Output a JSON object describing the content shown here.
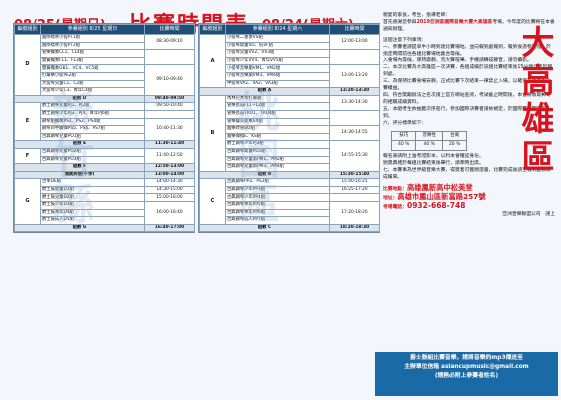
{
  "title": {
    "date_left": "08/25(星期日)",
    "main": "比賽時間表",
    "date_right": "08/24(星期六)"
  },
  "left_panel": {
    "headers": [
      "編號組別",
      "參賽組別 8/25 星期日",
      "比賽時間"
    ],
    "rows": [
      {
        "grp": "D",
        "items": [
          "國際標準小提PT1組",
          "國際標準小提PT2組",
          "管樂獨奏CL1、CL4組",
          "雙簧獨奏FL1、FL3組",
          "雙簧獨奏OB1、VC4、VC5組",
          "打擊樂小提PE2組",
          "大提琴兒童C1、C2組",
          "大提琴少年C3、青年C4組"
        ],
        "times": [
          "08:30-09:10",
          "",
          "09:10-09:40"
        ]
      },
      {
        "rest": true,
        "label": "組數 D",
        "time": "09:40-09:50"
      },
      {
        "grp": "E",
        "items": [
          "爵士鋼琴兒童PJ1、PJ2組",
          "爵士鋼琴少年PJ3、PJ4、青年PJ6組",
          "鋼琴組獨奏PS1、PS2、PS4組",
          "鋼琴四手聯彈PS5、PS6、PS7組",
          "古典鋼琴兒童PO1組"
        ],
        "times": [
          "09:50-10:40",
          "",
          "10:40-11:30"
        ]
      },
      {
        "rest": true,
        "label": "組數 E",
        "time": "11:30-11:40"
      },
      {
        "grp": "F",
        "items": [
          "古典鋼琴兒童PO2組",
          "古典鋼琴兒童PO3組"
        ],
        "times": [
          "11:40-12:50"
        ]
      },
      {
        "rest": true,
        "label": "組數 F",
        "time": "12:50-13:00"
      },
      {
        "rest": true,
        "label": "頒獎典禮(午休)",
        "time": "13:00-14:00"
      },
      {
        "grp": "G",
        "items": [
          "古筝OE組",
          "爵士鼓幼童D1組",
          "爵士鼓兒童D2組",
          "爵士鼓少年D3組",
          "爵士鼓青年D4組",
          "爵士鼓成人D5組"
        ],
        "times": [
          "14:00-14:30",
          "14:30-15:00",
          "15:00-16:00",
          "16:00-16:40"
        ]
      },
      {
        "rest": true,
        "label": "組數 G",
        "time": "16:40-17:00"
      }
    ]
  },
  "mid_panel": {
    "headers": [
      "編號組別",
      "參賽組別 8/24 星期六",
      "比賽時間"
    ],
    "rows": [
      {
        "grp": "A",
        "items": [
          "小提琴二重奏VS組",
          "小提琴幼童VD、低VF組",
          "小提琴兒童VV2、VV3組",
          "小提琴少年VV4、青年VV5組",
          "小提琴音樂劇VM1、VM2組",
          "小提琴音樂劇VM3、VM4組",
          "中提琴VA1、VA2、VA3組"
        ],
        "times": [
          "12:00-13:00",
          "",
          "13:00-13:20"
        ]
      },
      {
        "rest": true,
        "label": "組數 A",
        "time": "13:20-13:30"
      },
      {
        "grp": "B",
        "items": [
          "馬林巴木琴打擊組",
          "管樂長笛FL1-FL2組",
          "管樂長笛TRU1、TRU4組",
          "管樂薩克斯風SX組",
          "國樂吹管BO組",
          "國樂彈撥E、KS組",
          "爵士鋼琴少年PJ3組",
          "古典鋼琴幼童PD1組",
          "古典鋼琴兒童第PM1、PM2組",
          "古典鋼琴兒童第PM3、PM4組"
        ],
        "times": [
          "13:30-14:30",
          "",
          "14:30-14:55",
          "14:55-15:30"
        ]
      },
      {
        "rest": true,
        "label": "組數 B",
        "time": "15:30-15:40"
      },
      {
        "grp": "C",
        "items": [
          "古典鋼琴PP2、PS1組",
          "古典鋼琴少年PP3組",
          "古典鋼琴少年PP4組",
          "古典鋼琴青年PP5組",
          "古典鋼琴青年PP6組",
          "古典鋼琴成人PP7組"
        ],
        "times": [
          "15:40-16:25",
          "16:25-17:20",
          "",
          "17:20-18:20"
        ]
      },
      {
        "rest": true,
        "label": "組數 C",
        "time": "18:20-18:30"
      }
    ]
  },
  "watermark": {
    "left": "新竹縣",
    "mid": "桃園區"
  },
  "notice": {
    "greeting": "親愛的家長，考生，指導老師：",
    "intro_1": "首先感謝您參與",
    "intro_red": "2019亞洲區國際音樂大賽大高雄區",
    "intro_2": "考場，今年度的比賽將在本會通知辦理。",
    "notes_title": "這個注意下列事項：",
    "notes": [
      "一、參賽者請提早半小時到達比賽場地，並向報到處報到，報到後憑參賽證，於指定時間前往各組比賽場地集合等候。",
      "入會場內等候，保持肅靜，勿大聲喧嘩、手機請轉成靜音，請勿攝影。",
      "二、本次比賽為大高雄區一次決賽，各組成績於該組比賽結束後15分鐘公告於報到處。",
      "三、為保持比賽會場安靜，正式比賽下次結束一律禁止入場，以確保其他考生比賽權益。",
      "四、符合獎勵辦法之名次請上官方網站查詢，考試截止時間後，本會將收取郵寄的相關成績資料。",
      "五、本組考生依抽籤次序進行，參加國際決賽者請依規定，於國際賽日期前報到。",
      "六、評分標準如下："
    ],
    "score_headers": [
      "技巧",
      "音樂性",
      "台風"
    ],
    "score_values": [
      "40 %",
      "40 %",
      "20 %"
    ],
    "notes_2": [
      "報名表請附上准考證影本，以利本會確認身份。",
      "頒獎典禮於每組比賽結束後舉行，請準時出席。",
      "七、本賽事為世界級音樂大賽，得獎者可獲頒證書，比賽完成後請至報到處領取成績單。"
    ],
    "venue_prefix": "比賽地點：",
    "venue": "高雄鳳新高中松美堂",
    "address_prefix": "地址：",
    "address": "高雄市鳳山區新富路257號",
    "phone_prefix": "考場電話：",
    "phone": "0932-668-748",
    "signature": "亞洲音樂聯盟公司　謹上",
    "big_red": "大高雄區"
  },
  "footer": {
    "line1": "爵士鼓組比賽音樂，請將音樂的mp3傳送至",
    "line2": "主辦單位信箱 asiancupmusic@gmail.com",
    "line3": "(請務必附上參賽者姓名)"
  }
}
